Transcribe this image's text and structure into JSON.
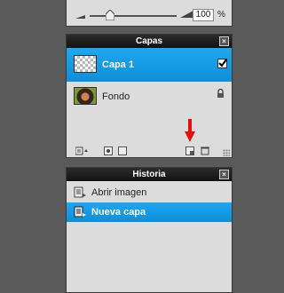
{
  "top_panel": {
    "zoom_value": "100",
    "zoom_unit": "%"
  },
  "layers_panel": {
    "title": "Capas",
    "layers": [
      {
        "name": "Capa 1",
        "selected": true,
        "visible": true
      },
      {
        "name": "Fondo",
        "selected": false,
        "locked": true
      }
    ]
  },
  "history_panel": {
    "title": "Historia",
    "items": [
      {
        "label": "Abrir imagen",
        "selected": false
      },
      {
        "label": "Nueva capa",
        "selected": true
      }
    ]
  },
  "annotation": {
    "arrow_color": "#e01010"
  },
  "colors": {
    "selection": "#1a9ee6",
    "panel_bg": "#dcdcdc",
    "title_bg": "#1a1a1a",
    "app_bg": "#5a5a5a"
  }
}
